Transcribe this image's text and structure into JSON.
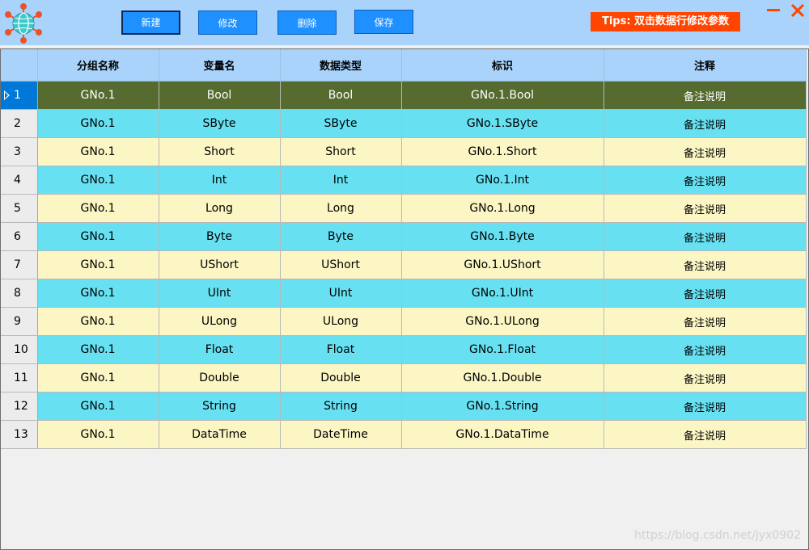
{
  "toolbar": {
    "buttons": [
      {
        "label": "新建",
        "active": true
      },
      {
        "label": "修改",
        "active": false
      },
      {
        "label": "删除",
        "active": false
      },
      {
        "label": "保存",
        "active": false
      }
    ],
    "tips": "Tips: 双击数据行修改参数"
  },
  "colors": {
    "titlebar": "#a9d3fb",
    "button": "#1e90ff",
    "tips": "#ff4500",
    "row_even": "#67e1f2",
    "row_odd": "#fbf6c4",
    "row_selected": "#556b2f",
    "row_header_selected": "#0078d7",
    "window_controls": "#ff4500"
  },
  "icons": {
    "logo": "globe-network-icon",
    "minimize": "minimize-icon",
    "close": "close-icon",
    "selected_row": "triangle-right-icon"
  },
  "table": {
    "columns": [
      "分组名称",
      "变量名",
      "数据类型",
      "标识",
      "注释"
    ],
    "selected_row": 0,
    "rows": [
      {
        "no": "1",
        "group": "GNo.1",
        "name": "Bool",
        "type": "Bool",
        "id": "GNo.1.Bool",
        "note": "备注说明"
      },
      {
        "no": "2",
        "group": "GNo.1",
        "name": "SByte",
        "type": "SByte",
        "id": "GNo.1.SByte",
        "note": "备注说明"
      },
      {
        "no": "3",
        "group": "GNo.1",
        "name": "Short",
        "type": "Short",
        "id": "GNo.1.Short",
        "note": "备注说明"
      },
      {
        "no": "4",
        "group": "GNo.1",
        "name": "Int",
        "type": "Int",
        "id": "GNo.1.Int",
        "note": "备注说明"
      },
      {
        "no": "5",
        "group": "GNo.1",
        "name": "Long",
        "type": "Long",
        "id": "GNo.1.Long",
        "note": "备注说明"
      },
      {
        "no": "6",
        "group": "GNo.1",
        "name": "Byte",
        "type": "Byte",
        "id": "GNo.1.Byte",
        "note": "备注说明"
      },
      {
        "no": "7",
        "group": "GNo.1",
        "name": "UShort",
        "type": "UShort",
        "id": "GNo.1.UShort",
        "note": "备注说明"
      },
      {
        "no": "8",
        "group": "GNo.1",
        "name": "UInt",
        "type": "UInt",
        "id": "GNo.1.UInt",
        "note": "备注说明"
      },
      {
        "no": "9",
        "group": "GNo.1",
        "name": "ULong",
        "type": "ULong",
        "id": "GNo.1.ULong",
        "note": "备注说明"
      },
      {
        "no": "10",
        "group": "GNo.1",
        "name": "Float",
        "type": "Float",
        "id": "GNo.1.Float",
        "note": "备注说明"
      },
      {
        "no": "11",
        "group": "GNo.1",
        "name": "Double",
        "type": "Double",
        "id": "GNo.1.Double",
        "note": "备注说明"
      },
      {
        "no": "12",
        "group": "GNo.1",
        "name": "String",
        "type": "String",
        "id": "GNo.1.String",
        "note": "备注说明"
      },
      {
        "no": "13",
        "group": "GNo.1",
        "name": "DataTime",
        "type": "DateTime",
        "id": "GNo.1.DataTime",
        "note": "备注说明"
      }
    ]
  },
  "watermark": "https://blog.csdn.net/jyx0902"
}
